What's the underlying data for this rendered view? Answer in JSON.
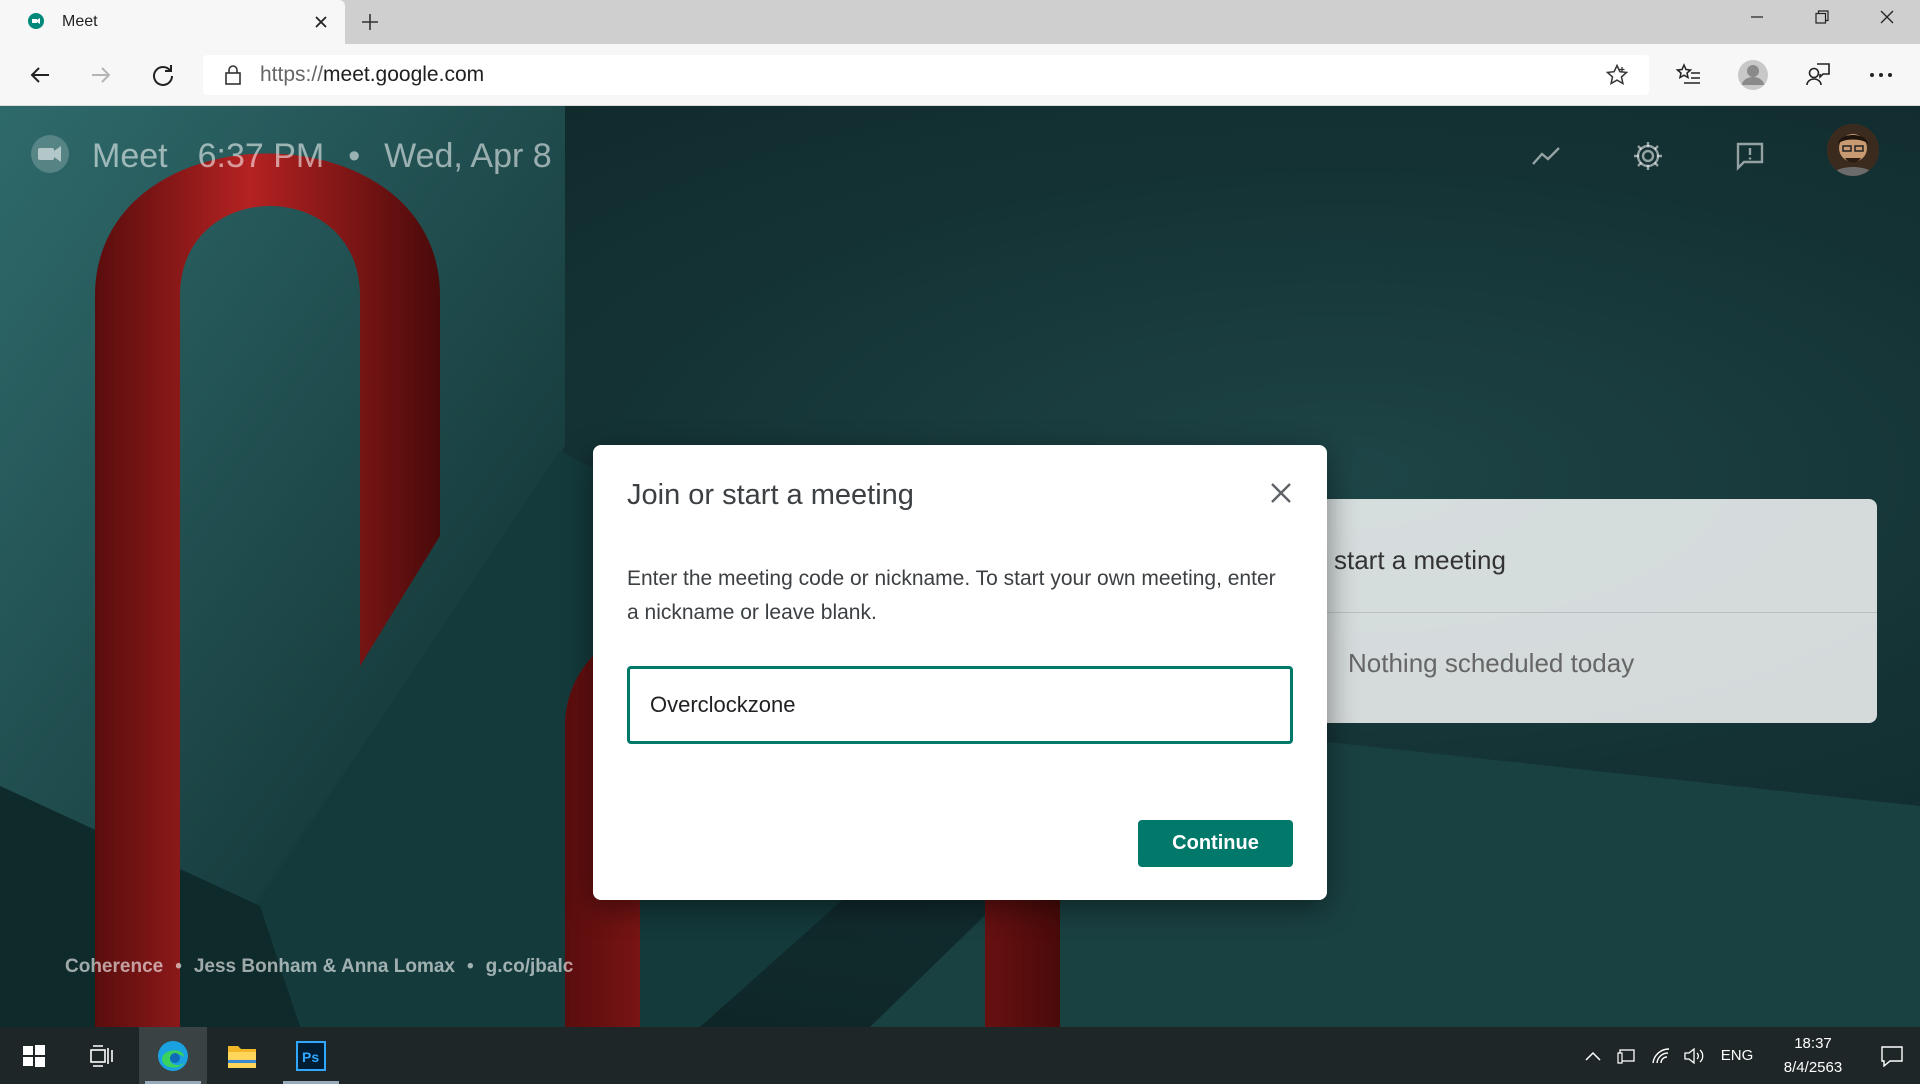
{
  "browser": {
    "tab_title": "Meet",
    "url_prefix": "https://",
    "url_host": "meet.google.com"
  },
  "meet": {
    "app_name": "Meet",
    "time": "6:37 PM",
    "separator": "•",
    "date": "Wed, Apr 8",
    "side_card": {
      "start_label": "start a meeting",
      "nothing_scheduled": "Nothing scheduled today"
    },
    "credit": {
      "title": "Coherence",
      "authors": "Jess Bonham & Anna Lomax",
      "link": "g.co/jbalc",
      "sep": "•"
    }
  },
  "dialog": {
    "title": "Join or start a meeting",
    "description": "Enter the meeting code or nickname. To start your own meeting, enter a nickname or leave blank.",
    "input_value": "Overclockzone",
    "continue_label": "Continue"
  },
  "taskbar": {
    "language": "ENG",
    "clock_time": "18:37",
    "clock_date": "8/4/2563"
  },
  "colors": {
    "accent": "#00796b",
    "page_bg": "#143234",
    "taskbar": "#1f2628"
  }
}
